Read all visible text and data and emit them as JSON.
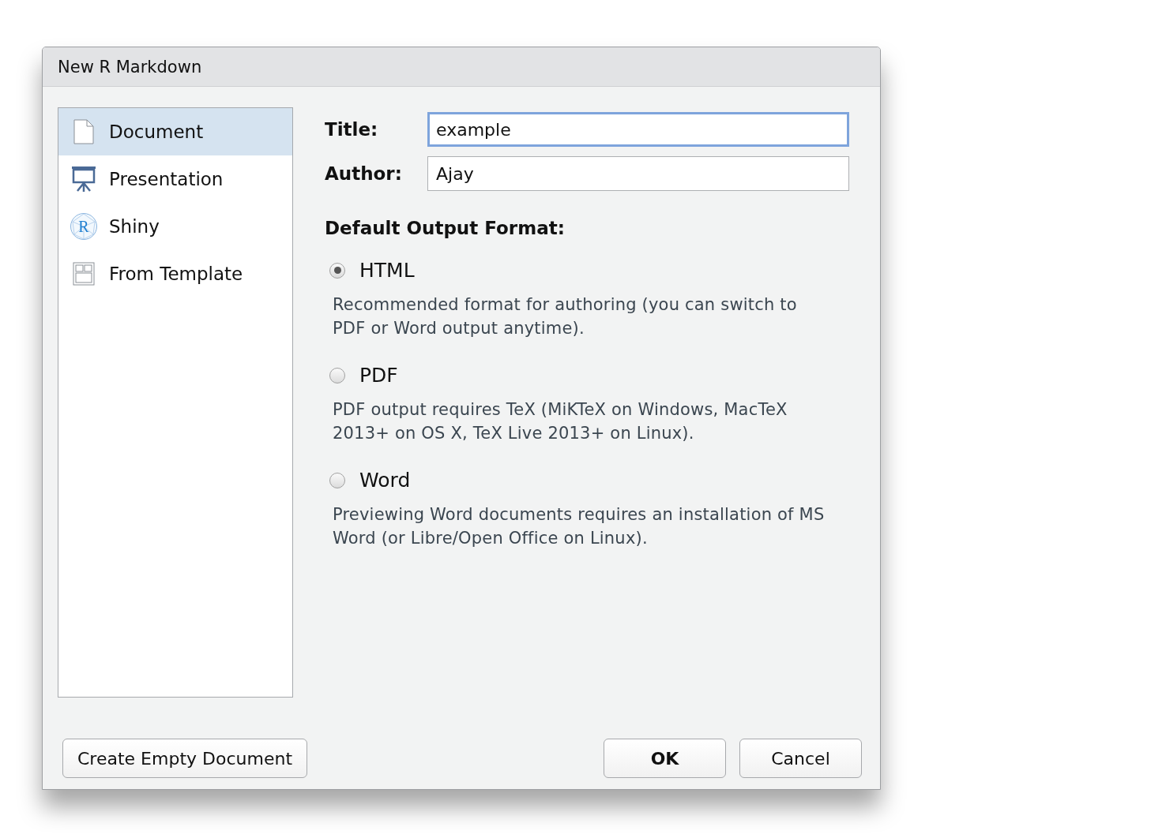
{
  "window": {
    "title": "New R Markdown"
  },
  "sidebar": {
    "items": [
      {
        "label": "Document",
        "kind": "document",
        "selected": true
      },
      {
        "label": "Presentation",
        "kind": "presentation",
        "selected": false
      },
      {
        "label": "Shiny",
        "kind": "shiny",
        "icon_text": "R",
        "selected": false
      },
      {
        "label": "From Template",
        "kind": "template",
        "selected": false
      }
    ]
  },
  "fields": [
    {
      "label": "Title:",
      "value": "example",
      "focused": true
    },
    {
      "label": "Author:",
      "value": "Ajay",
      "focused": false
    }
  ],
  "output_format": {
    "heading": "Default Output Format:",
    "options": [
      {
        "label": "HTML",
        "selected": true,
        "description": "Recommended format for authoring (you can switch to PDF or Word output anytime)."
      },
      {
        "label": "PDF",
        "selected": false,
        "description": "PDF output requires TeX (MiKTeX on Windows, MacTeX 2013+ on OS X, TeX Live 2013+ on Linux)."
      },
      {
        "label": "Word",
        "selected": false,
        "description": "Previewing Word documents requires an installation of MS Word (or Libre/Open Office on Linux)."
      }
    ]
  },
  "buttons": {
    "left": "Create Empty Document",
    "ok": "OK",
    "cancel": "Cancel"
  }
}
